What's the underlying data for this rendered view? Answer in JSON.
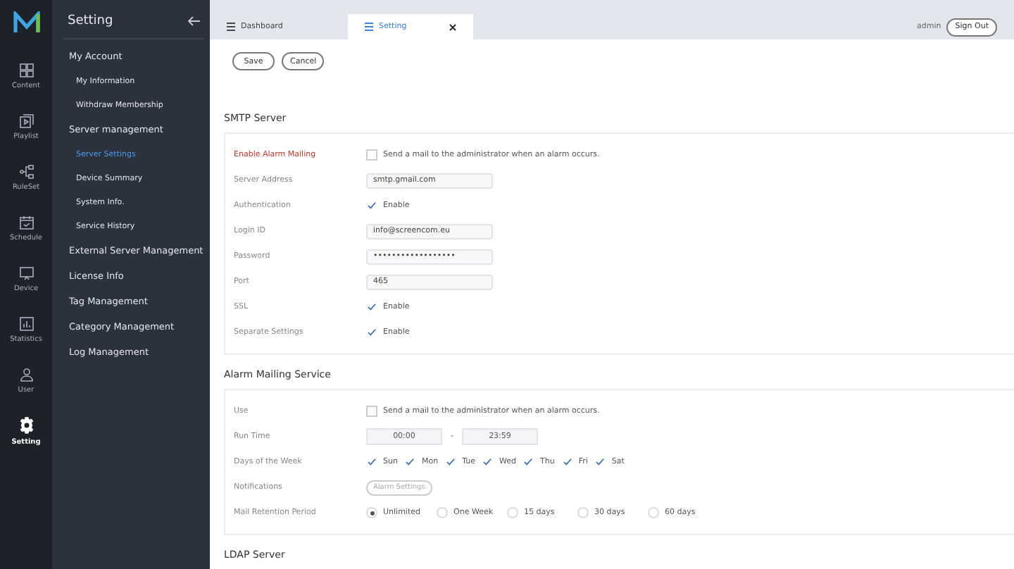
{
  "rail": {
    "items": [
      {
        "label": "Content",
        "selected": false
      },
      {
        "label": "Playlist",
        "selected": false
      },
      {
        "label": "RuleSet",
        "selected": false
      },
      {
        "label": "Schedule",
        "selected": false
      },
      {
        "label": "Device",
        "selected": false
      },
      {
        "label": "Statistics",
        "selected": false
      },
      {
        "label": "User",
        "selected": false
      },
      {
        "label": "Setting",
        "selected": true
      }
    ]
  },
  "menu": {
    "title": "Setting",
    "items": [
      {
        "label": "My Account",
        "selected": false,
        "children": [
          {
            "label": "My Information",
            "selected": false
          },
          {
            "label": "Withdraw Membership",
            "selected": false
          }
        ]
      },
      {
        "label": "Server management",
        "selected": false,
        "children": [
          {
            "label": "Server Settings",
            "selected": true
          },
          {
            "label": "Device Summary",
            "selected": false
          },
          {
            "label": "System Info.",
            "selected": false
          },
          {
            "label": "Service History",
            "selected": false
          }
        ]
      },
      {
        "label": "External Server Management",
        "selected": false
      },
      {
        "label": "License Info",
        "selected": false
      },
      {
        "label": "Tag Management",
        "selected": false
      },
      {
        "label": "Category Management",
        "selected": false
      },
      {
        "label": "Log Management",
        "selected": false
      }
    ]
  },
  "tabs": [
    {
      "label": "Dashboard",
      "selected": false,
      "closable": false
    },
    {
      "label": "Setting",
      "selected": true,
      "closable": true
    }
  ],
  "header": {
    "user": "admin",
    "sign_out": "Sign Out"
  },
  "actions": [
    "Save",
    "Cancel"
  ],
  "sections": [
    {
      "title": "SMTP Server",
      "rows": [
        {
          "label": "Enable Alarm Mailing",
          "highlight": true,
          "kind": "check",
          "checked": false,
          "text": "Send a mail to the administrator when an alarm occurs."
        },
        {
          "label": "Server Address",
          "highlight": false,
          "kind": "input",
          "value": "smtp.gmail.com"
        },
        {
          "label": "Authentication",
          "highlight": false,
          "kind": "check",
          "checked": true,
          "text": "Enable"
        },
        {
          "label": "Login ID",
          "highlight": false,
          "kind": "input",
          "value": "info@screencom.eu"
        },
        {
          "label": "Password",
          "highlight": false,
          "kind": "input",
          "value": "••••••••••••••••••"
        },
        {
          "label": "Port",
          "highlight": false,
          "kind": "input",
          "value": "465"
        },
        {
          "label": "SSL",
          "highlight": false,
          "kind": "check",
          "checked": true,
          "text": "Enable"
        },
        {
          "label": "Separate Settings",
          "highlight": false,
          "kind": "check",
          "checked": true,
          "text": "Enable"
        }
      ]
    },
    {
      "title": "Alarm Mailing Service",
      "rows": [
        {
          "label": "Use",
          "highlight": false,
          "kind": "check",
          "checked": false,
          "text": "Send a mail to the administrator when an alarm occurs."
        },
        {
          "label": "Run Time",
          "highlight": false,
          "kind": "time",
          "start": "00:00",
          "separator": "-",
          "end": "23:59"
        },
        {
          "label": "Days of the Week",
          "highlight": false,
          "kind": "days",
          "options": [
            {
              "text": "Sun",
              "checked": true
            },
            {
              "text": "Mon",
              "checked": true
            },
            {
              "text": "Tue",
              "checked": true
            },
            {
              "text": "Wed",
              "checked": true
            },
            {
              "text": "Thu",
              "checked": true
            },
            {
              "text": "Fri",
              "checked": true
            },
            {
              "text": "Sat",
              "checked": true
            }
          ]
        },
        {
          "label": "Notifications",
          "highlight": false,
          "kind": "button",
          "button": "Alarm Settings"
        },
        {
          "label": "Mail Retention Period",
          "highlight": false,
          "kind": "radio",
          "options": [
            {
              "text": "Unlimited",
              "selected": true
            },
            {
              "text": "One Week",
              "selected": false
            },
            {
              "text": "15 days",
              "selected": false
            },
            {
              "text": "30 days",
              "selected": false
            },
            {
              "text": "60 days",
              "selected": false
            }
          ]
        }
      ]
    },
    {
      "title": "LDAP Server"
    }
  ]
}
